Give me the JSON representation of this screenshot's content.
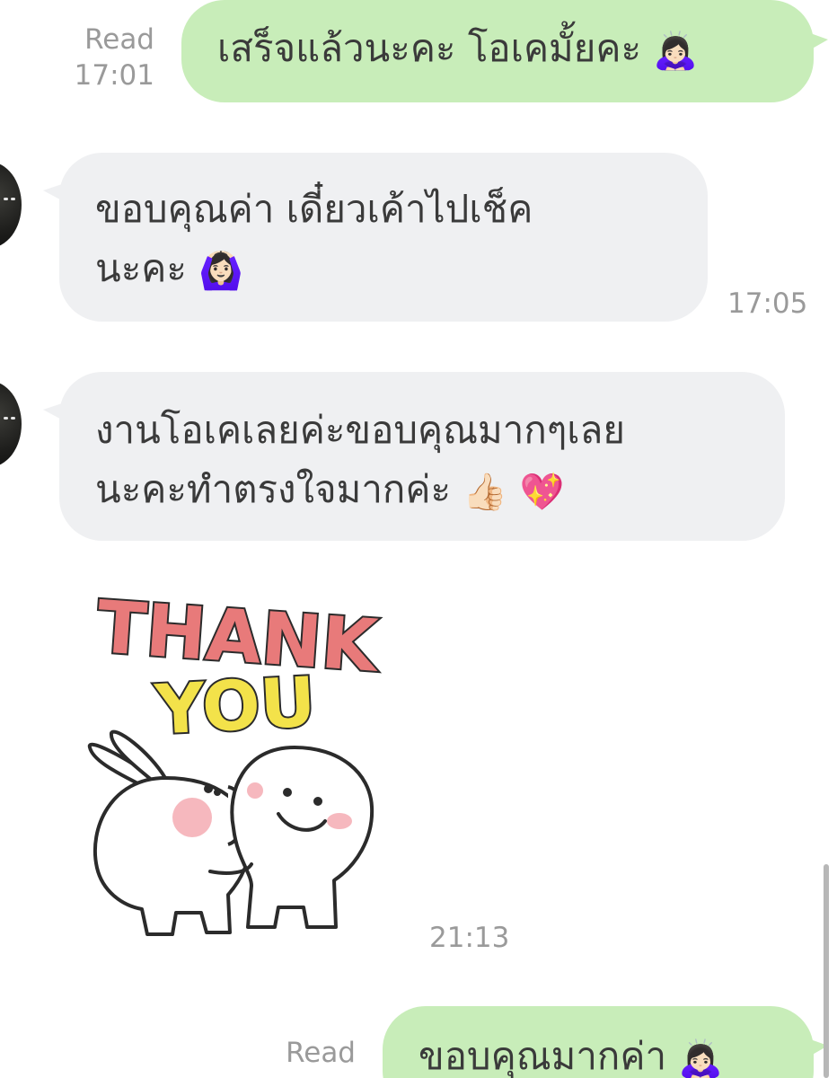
{
  "messages": {
    "m1": {
      "direction": "outgoing",
      "text": "เสร็จแล้วนะคะ โอเคมั้ยคะ",
      "emoji": "🙇🏻‍♀️",
      "emoji_name": "person-bowing-icon",
      "read_label": "Read",
      "time": "17:01"
    },
    "m2": {
      "direction": "incoming",
      "line1": "ขอบคุณค่า เดี๋ยวเค้าไปเช็ค",
      "line2": "นะคะ",
      "emoji": "🙆🏻‍♀️",
      "emoji_name": "person-gesturing-ok-icon",
      "time": "17:05"
    },
    "m3": {
      "direction": "incoming",
      "line1": "งานโอเคเลยค่ะขอบคุณมากๆเลย",
      "line2": "นะคะทำตรงใจมากค่ะ",
      "emoji1": "👍🏻",
      "emoji1_name": "thumbs-up-icon",
      "emoji2": "💖",
      "emoji2_name": "sparkling-heart-icon"
    },
    "sticker": {
      "direction": "incoming",
      "word1": "THANK",
      "word2": "YOU",
      "word1_color": "#e87a7a",
      "word2_color": "#f3e24a",
      "time": "21:13"
    },
    "m4": {
      "direction": "outgoing",
      "text": "ขอบคุณมากค่า",
      "emoji": "🙇🏻‍♀️",
      "emoji_name": "person-bowing-icon",
      "read_label": "Read"
    }
  },
  "colors": {
    "outgoing_bubble": "#c8edb9",
    "incoming_bubble": "#eff0f2",
    "meta_text": "#9a9a9a",
    "message_text": "#3a3a3a"
  }
}
